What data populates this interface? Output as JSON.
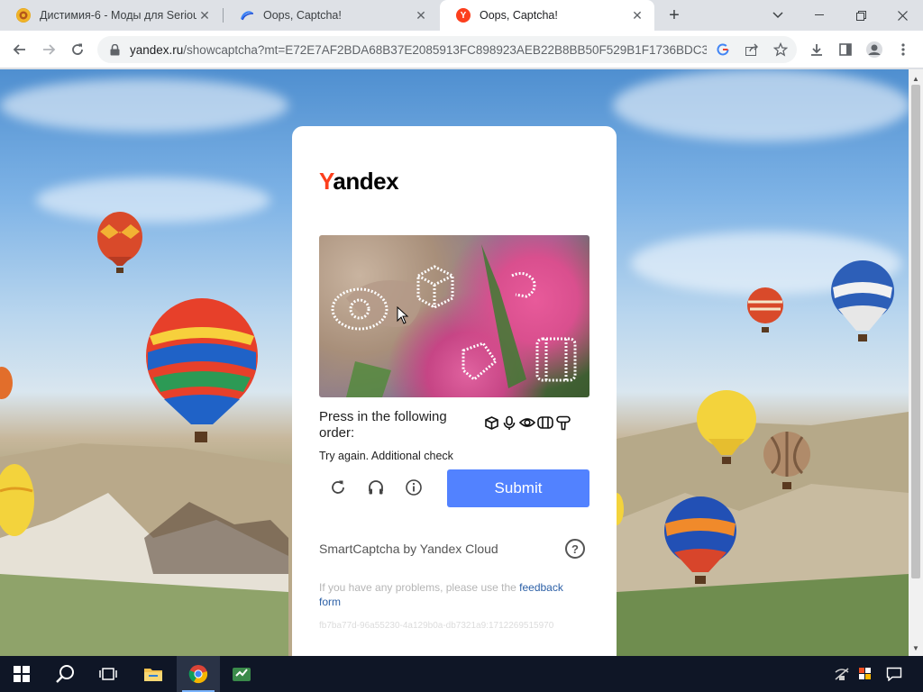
{
  "browser": {
    "tabs": [
      {
        "title": "Дистимия-6 - Моды для Serious",
        "favicon": "serious-sam-icon",
        "active": false
      },
      {
        "title": "Oops, Captcha!",
        "favicon": "smartcaptcha-icon",
        "active": false
      },
      {
        "title": "Oops, Captcha!",
        "favicon": "yandex-y-icon",
        "active": true
      }
    ],
    "new_tab": "+",
    "url_host": "yandex.ru",
    "url_path": "/showcaptcha?mt=E72E7AF2BDA68B37E2085913FC898923AEB22B8BB50F529B1F1736BDC3...",
    "omnibox_icons": [
      "google-lens-icon",
      "share-icon",
      "star-icon"
    ],
    "toolbar_icons": [
      "download-icon",
      "side-panel-icon",
      "profile-icon",
      "menu-icon"
    ]
  },
  "captcha": {
    "logo_y": "Y",
    "logo_rest": "andex",
    "instruction": "Press in the following order:",
    "order_icons": [
      "box-icon",
      "microphone-icon",
      "eye-icon",
      "film-icon",
      "hairdryer-icon"
    ],
    "error": "Try again. Additional check",
    "controls": [
      "refresh-icon",
      "headphones-icon",
      "info-icon"
    ],
    "submit_label": "Submit",
    "brand": "SmartCaptcha by Yandex Cloud",
    "help": "?",
    "feedback_prefix": "If you have any problems, please use the ",
    "feedback_link": "feedback form",
    "request_id": "fb7ba77d-96a55230-4a129b0a-db7321a9:1712269515970",
    "accent": "#5282ff",
    "logo_red": "#fc3f1d"
  },
  "taskbar": {
    "items": [
      "windows-start-icon",
      "search-icon",
      "task-view-icon",
      "file-explorer-icon",
      "chrome-icon",
      "app-icon"
    ],
    "tray": [
      "network-icon",
      "notification-flag-icon",
      "action-center-icon"
    ]
  }
}
